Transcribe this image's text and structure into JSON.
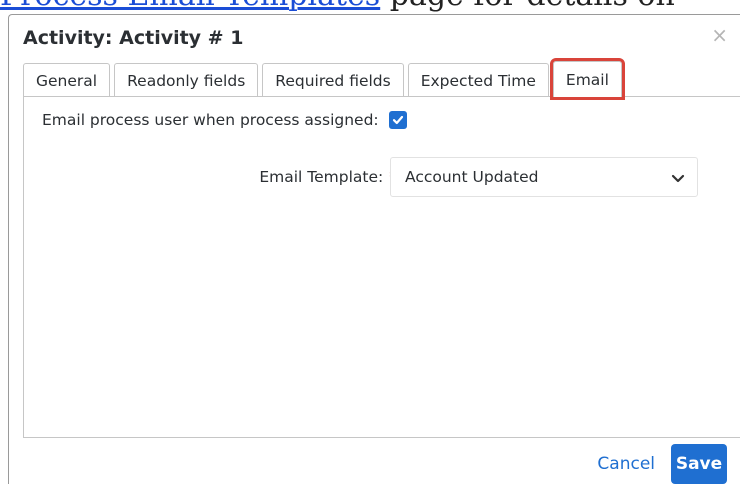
{
  "background": {
    "link_text": "Process Email Templates",
    "rest_text": " page for details on"
  },
  "dialog": {
    "title": "Activity: Activity # 1",
    "close_glyph": "×"
  },
  "tabs": [
    {
      "label": "General",
      "active": false
    },
    {
      "label": "Readonly fields",
      "active": false
    },
    {
      "label": "Required fields",
      "active": false
    },
    {
      "label": "Expected Time",
      "active": false
    },
    {
      "label": "Email",
      "active": true
    }
  ],
  "email_panel": {
    "assign_label": "Email process user when process assigned:",
    "assign_checked": true,
    "template_label": "Email Template:",
    "required_marker": "*",
    "template_value": "Account Updated"
  },
  "footer": {
    "cancel_label": "Cancel",
    "save_label": "Save"
  },
  "colors": {
    "accent": "#1f6fd1",
    "highlight": "#d9443a",
    "required": "#c0392b"
  }
}
